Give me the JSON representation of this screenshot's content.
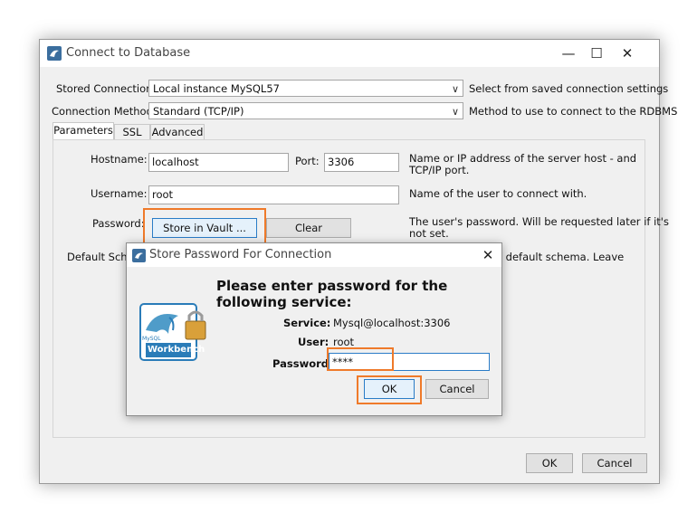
{
  "main_window": {
    "title": "Connect to Database",
    "stored_connection": {
      "label": "Stored Connection:",
      "value": "Local instance MySQL57",
      "hint": "Select from saved connection settings"
    },
    "connection_method": {
      "label": "Connection Method:",
      "value": "Standard (TCP/IP)",
      "hint": "Method to use to connect to the RDBMS"
    },
    "tabs": [
      {
        "label": "Parameters"
      },
      {
        "label": "SSL"
      },
      {
        "label": "Advanced"
      }
    ],
    "parameters": {
      "hostname_label": "Hostname:",
      "hostname_value": "localhost",
      "port_label": "Port:",
      "port_value": "3306",
      "hostname_hint_line1": "Name or IP address of the server host - and",
      "hostname_hint_line2": "TCP/IP port.",
      "username_label": "Username:",
      "username_value": "root",
      "username_hint": "Name of the user to connect with.",
      "password_label": "Password:",
      "store_in_vault_label": "Store in Vault ...",
      "clear_label": "Clear",
      "password_hint_line1": "The user's password. Will be requested later if it's",
      "password_hint_line2": "not set.",
      "default_schema_label_partial": "Default Schem",
      "default_schema_hint_partial": "s default schema. Leave"
    },
    "ok_label": "OK",
    "cancel_label": "Cancel"
  },
  "dialog": {
    "title": "Store Password For Connection",
    "heading_line1": "Please enter password for the",
    "heading_line2": "following service:",
    "service_label": "Service:",
    "service_value": "Mysql@localhost:3306",
    "user_label": "User:",
    "user_value": "root",
    "password_label": "Password:",
    "password_value": "****",
    "ok_label": "OK",
    "cancel_label": "Cancel",
    "logo_text_small": "MySQL",
    "logo_text": "Workbench"
  },
  "colors": {
    "highlight": "#ef7a2a",
    "logo_blue": "#2a7cb8"
  }
}
